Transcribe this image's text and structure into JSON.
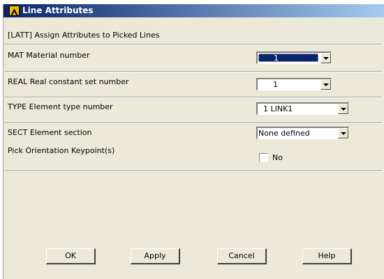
{
  "window": {
    "title": "Line Attributes",
    "close_glyph": "×"
  },
  "command": "[LATT] Assign Attributes to Picked Lines",
  "fields": {
    "mat": {
      "label": "MAT  Material number",
      "value": "1"
    },
    "real": {
      "label": "REAL  Real constant set number",
      "value": "1"
    },
    "type": {
      "label": "TYPE  Element type number",
      "value": "1    LINK1"
    },
    "sect": {
      "label": "SECT  Element section",
      "value": "None defined"
    },
    "pick": {
      "label": "Pick Orientation Keypoint(s)",
      "checkbox_label": "No",
      "checked": false
    }
  },
  "buttons": {
    "ok": "OK",
    "apply": "Apply",
    "cancel": "Cancel",
    "help": "Help"
  },
  "icons": {
    "title_logo": "ansys-logo-icon",
    "combo_arrow": "chevron-down-icon"
  },
  "colors": {
    "dialog_bg": "#ece9d8",
    "titlebar_start": "#0a246a",
    "titlebar_end": "#a6caf0",
    "selection": "#0a246a",
    "logo": "#f0c000"
  }
}
